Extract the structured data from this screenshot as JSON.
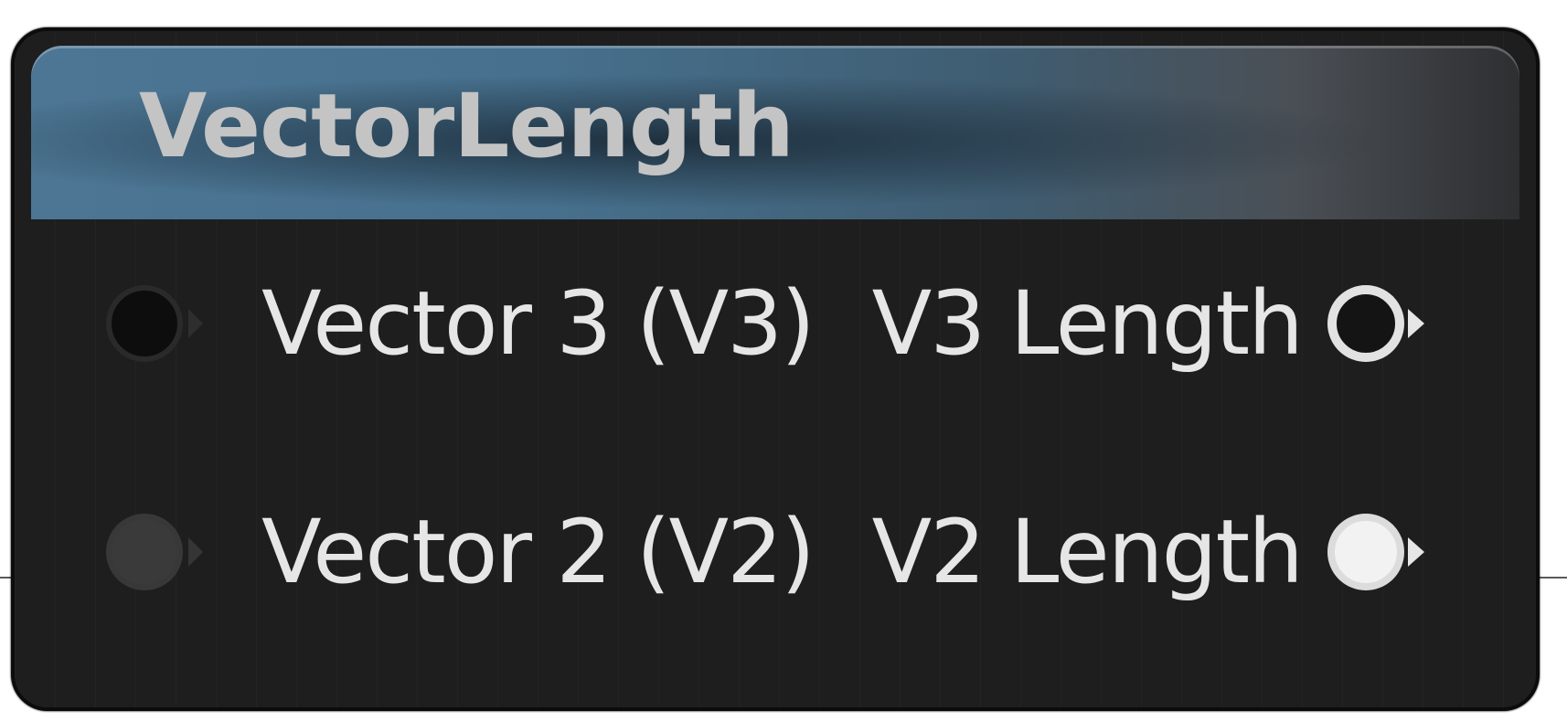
{
  "node": {
    "title": "VectorLength",
    "header_color": "#4c7694",
    "inputs": [
      {
        "label": "Vector 3 (V3)",
        "icon": "input-pin-icon",
        "connected": false
      },
      {
        "label": "Vector 2 (V2)",
        "icon": "input-pin-icon",
        "connected": false
      }
    ],
    "outputs": [
      {
        "label": "V3 Length",
        "icon": "output-pin-icon",
        "connected": false
      },
      {
        "label": "V2 Length",
        "icon": "output-pin-icon",
        "connected": true
      }
    ]
  }
}
